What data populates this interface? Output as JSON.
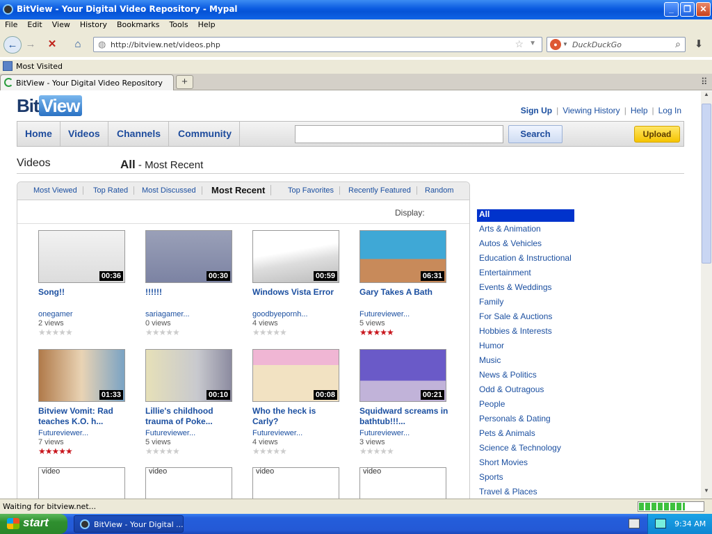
{
  "window": {
    "title": "BitView - Your Digital Video Repository - Mypal"
  },
  "menubar": [
    "File",
    "Edit",
    "View",
    "History",
    "Bookmarks",
    "Tools",
    "Help"
  ],
  "urlbar": {
    "url": "http://bitview.net/videos.php"
  },
  "searchbar": {
    "placeholder": "DuckDuckGo"
  },
  "bookmarks": {
    "most_visited": "Most Visited"
  },
  "tab": {
    "title": "BitView - Your Digital Video Repository"
  },
  "site": {
    "logo_left": "Bit",
    "logo_right": "View",
    "toplinks": [
      "Sign Up",
      "Viewing History",
      "Help",
      "Log In"
    ],
    "nav": [
      "Home",
      "Videos",
      "Channels",
      "Community"
    ],
    "search_btn": "Search",
    "upload_btn": "Upload",
    "section": "Videos",
    "crumb_bold": "All",
    "crumb_rest": " - Most Recent",
    "subtabs": [
      "Most Viewed",
      "Top Rated",
      "Most Discussed",
      "Most Recent",
      "Top Favorites",
      "Recently Featured",
      "Random"
    ],
    "display_label": "Display:"
  },
  "videos": [
    {
      "title": "Song!!",
      "user": "onegamer",
      "views": "2 views",
      "duration": "00:36",
      "rating": 0
    },
    {
      "title": "!!!!!!",
      "user": "sariagamer...",
      "views": "0 views",
      "duration": "00:30",
      "rating": 0
    },
    {
      "title": "Windows Vista Error",
      "user": "goodbyepornh...",
      "views": "4 views",
      "duration": "00:59",
      "rating": 0
    },
    {
      "title": "Gary Takes A Bath",
      "user": "Futureviewer...",
      "views": "5 views",
      "duration": "06:31",
      "rating": 5
    },
    {
      "title": "Bitview Vomit: Rad teaches K.O. h...",
      "user": "Futureviewer...",
      "views": "7 views",
      "duration": "01:33",
      "rating": 5
    },
    {
      "title": "Lillie's childhood trauma of Poke...",
      "user": "Futureviewer...",
      "views": "5 views",
      "duration": "00:10",
      "rating": 0
    },
    {
      "title": "Who the heck is Carly?",
      "user": "Futureviewer...",
      "views": "4 views",
      "duration": "00:08",
      "rating": 0
    },
    {
      "title": "Squidward screams in bathtub!!!...",
      "user": "Futureviewer...",
      "views": "3 views",
      "duration": "00:21",
      "rating": 0
    }
  ],
  "placeholders": [
    "video",
    "video",
    "video",
    "video"
  ],
  "categories": [
    "All",
    "Arts & Animation",
    "Autos & Vehicles",
    "Education & Instructional",
    "Entertainment",
    "Events & Weddings",
    "Family",
    "For Sale & Auctions",
    "Hobbies & Interests",
    "Humor",
    "Music",
    "News & Politics",
    "Odd & Outragous",
    "People",
    "Personals & Dating",
    "Pets & Animals",
    "Science & Technology",
    "Short Movies",
    "Sports",
    "Travel & Places"
  ],
  "status": {
    "text": "Waiting for bitview.net...",
    "progress": 0.72
  },
  "taskbar": {
    "start": "start",
    "task": "BitView - Your Digital ...",
    "clock": "9:34 AM"
  },
  "colors": {
    "link": "#1b4fa0",
    "upload": "#f5c400",
    "category_selected": "#0033cc",
    "rating_star": "#c8161d"
  }
}
